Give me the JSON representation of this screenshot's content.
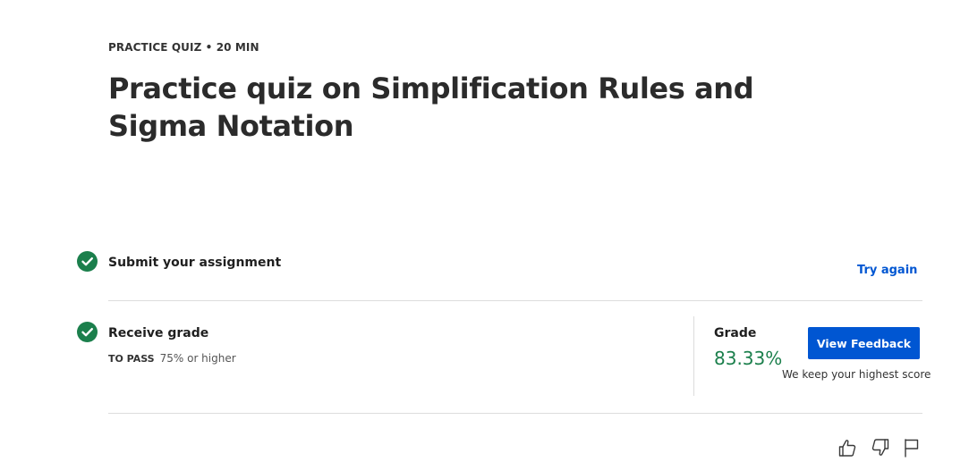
{
  "header": {
    "eyebrow": "PRACTICE QUIZ • 20 MIN",
    "title": "Practice quiz on Simplification Rules and Sigma Notation"
  },
  "steps": {
    "submit": {
      "label": "Submit your assignment",
      "status_icon": "check-circle-icon",
      "action": "Try again"
    },
    "receive": {
      "label": "Receive grade",
      "status_icon": "check-circle-icon",
      "to_pass_label": "TO PASS",
      "to_pass_value": "75% or higher"
    }
  },
  "grade": {
    "label": "Grade",
    "value": "83.33%",
    "button_label": "View Feedback",
    "note": "We keep your highest score"
  },
  "footer_actions": {
    "like_icon": "thumbs-up-icon",
    "dislike_icon": "thumbs-down-icon",
    "report_icon": "flag-icon"
  },
  "colors": {
    "success": "#1b7f4c",
    "link": "#0056d2",
    "button": "#0056d2",
    "divider": "#dcdcdc"
  }
}
